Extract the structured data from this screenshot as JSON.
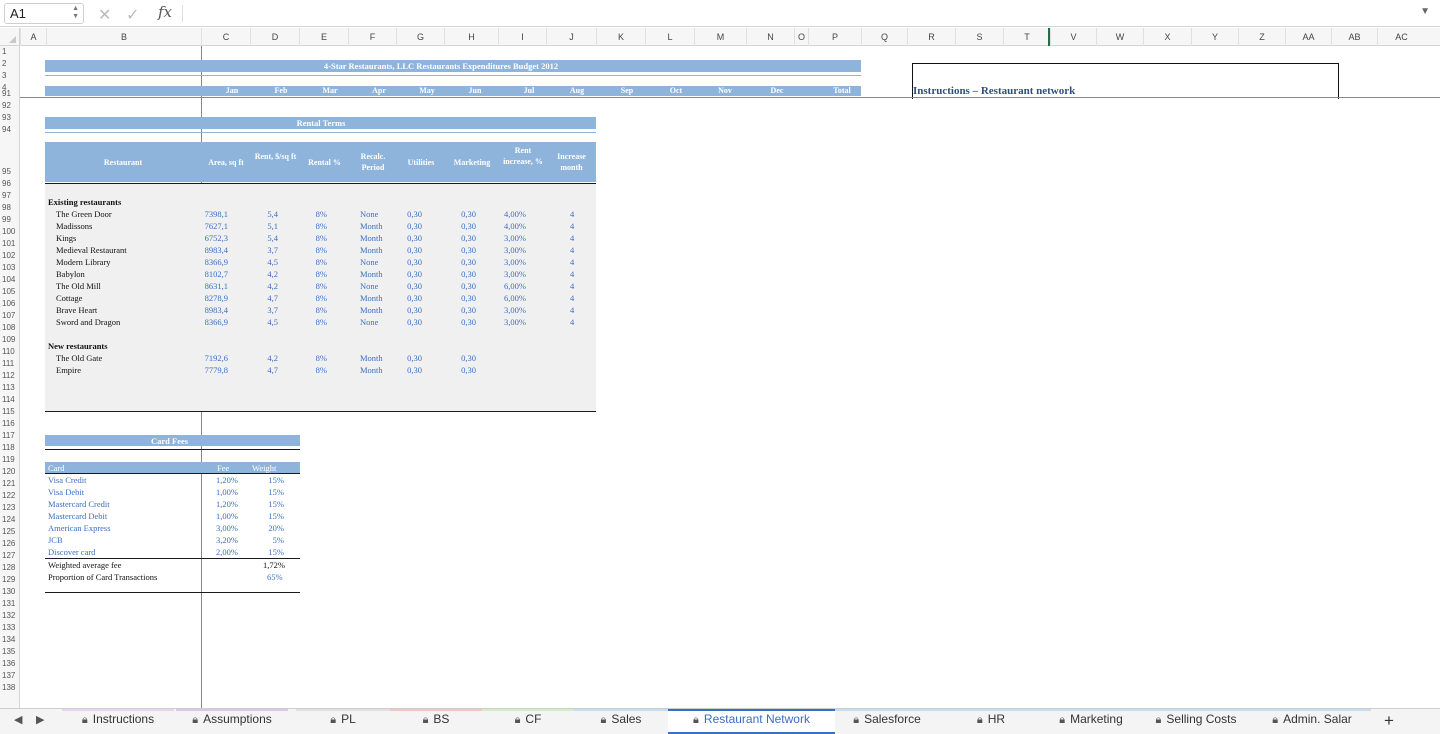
{
  "formula_bar": {
    "cell_ref": "A1",
    "fx": "fx",
    "value": ""
  },
  "columns": [
    "A",
    "B",
    "C",
    "D",
    "E",
    "F",
    "G",
    "H",
    "I",
    "J",
    "K",
    "L",
    "M",
    "N",
    "O",
    "P",
    "Q",
    "R",
    "S",
    "T",
    "V",
    "W",
    "X",
    "Y",
    "Z",
    "AA",
    "AB",
    "AC"
  ],
  "rows": [
    "1",
    "2",
    "3",
    "4",
    "91",
    "92",
    "93",
    "94",
    "95",
    "96",
    "97",
    "98",
    "99",
    "100",
    "101",
    "102",
    "103",
    "104",
    "105",
    "106",
    "107",
    "108",
    "109",
    "110",
    "111",
    "112",
    "113",
    "114",
    "115",
    "116",
    "117",
    "118",
    "119",
    "120",
    "121",
    "122",
    "123",
    "124",
    "125",
    "126",
    "127",
    "128",
    "129",
    "130",
    "131",
    "132",
    "133",
    "134",
    "135",
    "136",
    "137",
    "138"
  ],
  "budget": {
    "title": "4-Star Restaurants, LLC Restaurants Expenditures Budget 2012",
    "months": [
      "Jan",
      "Feb",
      "Mar",
      "Apr",
      "May",
      "Jun",
      "Jul",
      "Aug",
      "Sep",
      "Oct",
      "Nov",
      "Dec",
      "Total"
    ]
  },
  "instructions_box": {
    "title": "Instructions – Restaurant network"
  },
  "rental": {
    "title": "Rental Terms",
    "headers": [
      "Restaurant",
      "Area, sq ft",
      "Rent, $/sq ft",
      "Rental %",
      "Recalc. Period",
      "Utilities",
      "Marketing",
      "Rent increase, %",
      "Increase month"
    ],
    "existing_label": "Existing restaurants",
    "existing": [
      [
        "The Green Door",
        "7398,1",
        "5,4",
        "8%",
        "None",
        "0,30",
        "0,30",
        "4,00%",
        "4"
      ],
      [
        "Madissons",
        "7627,1",
        "5,1",
        "8%",
        "Month",
        "0,30",
        "0,30",
        "4,00%",
        "4"
      ],
      [
        "Kings",
        "6752,3",
        "5,4",
        "8%",
        "Month",
        "0,30",
        "0,30",
        "3,00%",
        "4"
      ],
      [
        "Medieval Restaurant",
        "8983,4",
        "3,7",
        "8%",
        "Month",
        "0,30",
        "0,30",
        "3,00%",
        "4"
      ],
      [
        "Modern Library",
        "8366,9",
        "4,5",
        "8%",
        "None",
        "0,30",
        "0,30",
        "3,00%",
        "4"
      ],
      [
        "Babylon",
        "8102,7",
        "4,2",
        "8%",
        "Month",
        "0,30",
        "0,30",
        "3,00%",
        "4"
      ],
      [
        "The Old Mill",
        "8631,1",
        "4,2",
        "8%",
        "None",
        "0,30",
        "0,30",
        "6,00%",
        "4"
      ],
      [
        "Cottage",
        "8278,9",
        "4,7",
        "8%",
        "Month",
        "0,30",
        "0,30",
        "6,00%",
        "4"
      ],
      [
        "Brave Heart",
        "8983,4",
        "3,7",
        "8%",
        "Month",
        "0,30",
        "0,30",
        "3,00%",
        "4"
      ],
      [
        "Sword and Dragon",
        "8366,9",
        "4,5",
        "8%",
        "None",
        "0,30",
        "0,30",
        "3,00%",
        "4"
      ]
    ],
    "new_label": "New restaurants",
    "new": [
      [
        "The Old Gate",
        "7192,6",
        "4,2",
        "8%",
        "Month",
        "0,30",
        "0,30"
      ],
      [
        "Empire",
        "7779,8",
        "4,7",
        "8%",
        "Month",
        "0,30",
        "0,30"
      ]
    ]
  },
  "card_fees": {
    "title": "Card Fees",
    "headers": [
      "Card",
      "Fee",
      "Weight"
    ],
    "rows": [
      [
        "Visa Credit",
        "1,20%",
        "15%"
      ],
      [
        "Visa Debit",
        "1,00%",
        "15%"
      ],
      [
        "Mastercard Credit",
        "1,20%",
        "15%"
      ],
      [
        "Mastercard Debit",
        "1,00%",
        "15%"
      ],
      [
        "American Express",
        "3,00%",
        "20%"
      ],
      [
        "JCB",
        "3,20%",
        "5%"
      ],
      [
        "Discover card",
        "2,00%",
        "15%"
      ]
    ],
    "weighted_label": "Weighted average fee",
    "weighted_value": "1,72%",
    "proportion_label": "Proportion of Card Transactions",
    "proportion_value": "65%"
  },
  "tabs": [
    {
      "label": "Instructions",
      "color": "#e7d6f0"
    },
    {
      "label": "Assumptions",
      "color": "#d8c8e8"
    },
    {
      "label": "PL",
      "color": "#e0e0e0"
    },
    {
      "label": "BS",
      "color": "#f1c6c6"
    },
    {
      "label": "CF",
      "color": "#d6ecc8"
    },
    {
      "label": "Sales",
      "color": "#c8dcf0"
    },
    {
      "label": "Restaurant Network",
      "color": "#3a6fc4"
    },
    {
      "label": "Salesforce",
      "color": "#c8dcf0"
    },
    {
      "label": "HR",
      "color": "#c8dcf0"
    },
    {
      "label": "Marketing",
      "color": "#c8dcf0"
    },
    {
      "label": "Selling Costs",
      "color": "#c8dcf0"
    },
    {
      "label": "Admin. Salar",
      "color": "#c8dcf0"
    }
  ],
  "add_sheet": "+"
}
